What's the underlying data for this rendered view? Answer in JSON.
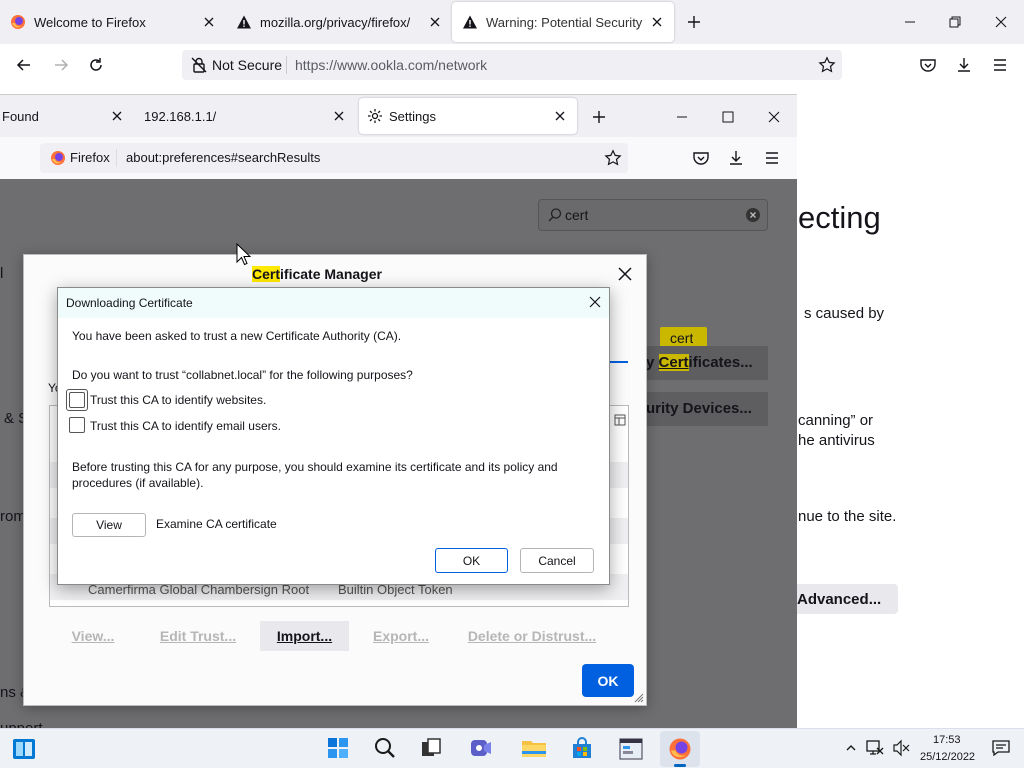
{
  "outer": {
    "tabs": [
      {
        "title": "Welcome to Firefox"
      },
      {
        "title": "mozilla.org/privacy/firefox/"
      },
      {
        "title": "Warning: Potential Security Risk Ahead"
      }
    ],
    "security_label": "Not Secure",
    "url": "https://www.ookla.com/network",
    "page": {
      "heading_fragment": "ecting",
      "line1": "s caused by",
      "line2": "canning” or",
      "line3": "he antivirus",
      "line4": "nue to the site.",
      "advanced_label": "Advanced..."
    }
  },
  "inner": {
    "tabs": [
      {
        "title": "Found"
      },
      {
        "title": "192.168.1.1/"
      },
      {
        "title": "Settings"
      }
    ],
    "identity_label": "Firefox",
    "url": "about:preferences#searchResults",
    "search_value": "cert",
    "cert_badge": "cert",
    "view_certificates_hl": "Cert",
    "view_certificates_pre": "y ",
    "view_certificates_post": "ificates...",
    "security_devices_label": "urity Devices...",
    "left_fragments": {
      "a": "l",
      "b": "& S",
      "c": "rom",
      "d": "ns &",
      "e": "upport"
    },
    "cert_manager": {
      "title_hl": "Cert",
      "title_rest": "ificate Manager",
      "intro_fragment": "Yo",
      "row_name": "Camerfirma Global Chambersign Root",
      "row_token": "Builtin Object Token",
      "buttons": {
        "view": "View...",
        "edit_trust": "Edit Trust...",
        "import": "Import...",
        "export": "Export...",
        "delete": "Delete or Distrust..."
      },
      "ok": "OK"
    }
  },
  "dialog": {
    "title": "Downloading Certificate",
    "intro": "You have been asked to trust a new Certificate Authority (CA).",
    "question": "Do you want to trust “collabnet.local” for the following purposes?",
    "trust_websites": {
      "label": "Trust this CA to identify websites.",
      "checked": false
    },
    "trust_email": {
      "label": "Trust this CA to identify email users.",
      "checked": false
    },
    "advice": "Before trusting this CA for any purpose, you should examine its certificate and its policy and procedures (if available).",
    "view_button": "View",
    "examine_label": "Examine CA certificate",
    "ok_button": "OK",
    "cancel_button": "Cancel"
  },
  "taskbar": {
    "time": "17:53",
    "date": "25/12/2022"
  },
  "colors": {
    "accent": "#0060df",
    "highlight": "#ffe900"
  }
}
